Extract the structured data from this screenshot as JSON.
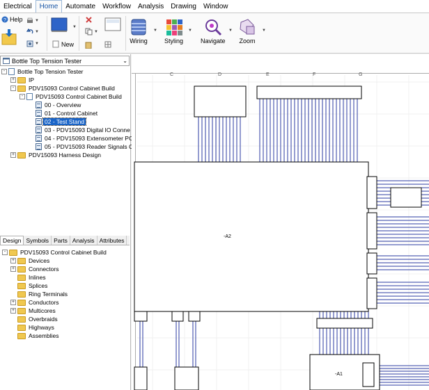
{
  "menu": {
    "items": [
      "Electrical",
      "Home",
      "Automate",
      "Workflow",
      "Analysis",
      "Drawing",
      "Window"
    ],
    "active": "Home"
  },
  "ribbon": {
    "help_label": "Help",
    "new_label": "New",
    "wiring_label": "Wiring",
    "styling_label": "Styling",
    "navigate_label": "Navigate",
    "zoom_label": "Zoom"
  },
  "project": {
    "selected": "Bottle Top Tension Tester"
  },
  "project_tree": [
    {
      "label": "Bottle Top Tension Tester",
      "icon": "doc-icon",
      "level": 0,
      "expander": "-"
    },
    {
      "label": "IP",
      "icon": "folder-icon",
      "level": 1,
      "expander": "+"
    },
    {
      "label": "PDV15093 Control Cabinet Build",
      "icon": "folder-icon",
      "level": 1,
      "expander": "-"
    },
    {
      "label": "PDV15093 Control Cabinet Build",
      "icon": "doc-icon",
      "level": 2,
      "expander": "-"
    },
    {
      "label": "00 - Overview",
      "icon": "page-icon",
      "level": 3,
      "expander": ""
    },
    {
      "label": "01 - Control Cabinet",
      "icon": "page-icon",
      "level": 3,
      "expander": ""
    },
    {
      "label": "02 - Test Stand",
      "icon": "page-icon",
      "level": 3,
      "expander": "",
      "selected": true
    },
    {
      "label": "03 - PDV15093 Digital IO Conne",
      "icon": "page-icon",
      "level": 3,
      "expander": ""
    },
    {
      "label": "04 - PDV15093 Extensometer PC",
      "icon": "page-icon",
      "level": 3,
      "expander": ""
    },
    {
      "label": "05 - PDV15093 Reader Signals C",
      "icon": "page-icon",
      "level": 3,
      "expander": ""
    },
    {
      "label": "PDV15093 Harness Design",
      "icon": "folder-icon",
      "level": 1,
      "expander": "+"
    }
  ],
  "panel_tabs": [
    "Design",
    "Symbols",
    "Parts",
    "Analysis",
    "Attributes"
  ],
  "active_tab": "Design",
  "design_tree": [
    {
      "label": "PDV15093 Control Cabinet Build",
      "level": 0,
      "expander": "-"
    },
    {
      "label": "Devices",
      "level": 1,
      "expander": "+"
    },
    {
      "label": "Connectors",
      "level": 1,
      "expander": "+"
    },
    {
      "label": "Inlines",
      "level": 1,
      "expander": ""
    },
    {
      "label": "Splices",
      "level": 1,
      "expander": ""
    },
    {
      "label": "Ring Terminals",
      "level": 1,
      "expander": ""
    },
    {
      "label": "Conductors",
      "level": 1,
      "expander": "+"
    },
    {
      "label": "Multicores",
      "level": 1,
      "expander": "+"
    },
    {
      "label": "Overbraids",
      "level": 1,
      "expander": ""
    },
    {
      "label": "Highways",
      "level": 1,
      "expander": ""
    },
    {
      "label": "Assemblies",
      "level": 1,
      "expander": ""
    }
  ],
  "drawing": {
    "columns": [
      "C",
      "D",
      "E",
      "F",
      "G"
    ],
    "device_a2": "-A2",
    "device_a1": "-A1"
  },
  "colors": {
    "wire": "#2a3aa0",
    "selection": "#1964c8",
    "active_menu": "#1a56a6"
  }
}
